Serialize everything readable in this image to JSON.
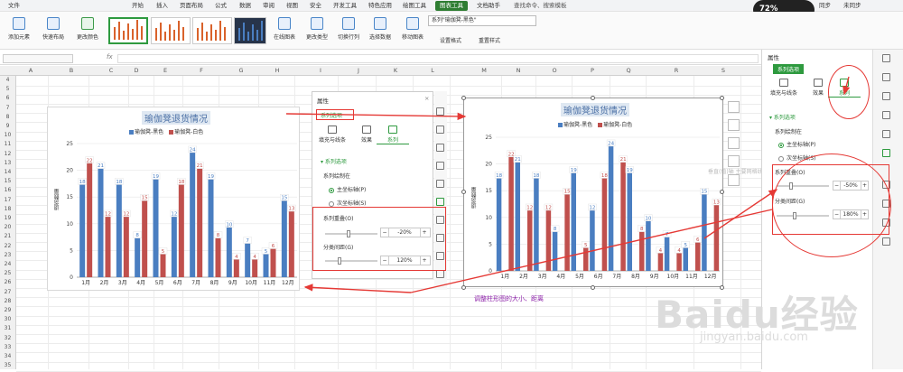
{
  "menubar": {
    "items": [
      "文件",
      "开始",
      "插入",
      "页面布局",
      "公式",
      "数据",
      "审阅",
      "视图",
      "安全",
      "开发工具",
      "特色应用",
      "绘图工具",
      "图表工具",
      "文档助手"
    ],
    "active": "图表工具",
    "search": "查找命令、搜索模板",
    "right_a": "同步",
    "right_b": "未同步"
  },
  "badge": {
    "value": "72%"
  },
  "ribbon": {
    "add_element": "添加元素",
    "quick_layout": "快速布局",
    "change_color": "更改颜色",
    "online_chart": "在线图表",
    "change_type": "更改类型",
    "switch_rowcol": "切换行列",
    "select_data": "选择数据",
    "move_chart": "移动图表",
    "style_select": "系列\"瑜伽凳-黑色\"",
    "set_format": "设置格式",
    "reset_style": "重置样式"
  },
  "formula": {
    "fx": "fx"
  },
  "columns": [
    "A",
    "B",
    "C",
    "D",
    "E",
    "F",
    "G",
    "H",
    "I",
    "J",
    "K",
    "L",
    "M",
    "N",
    "O",
    "P",
    "Q",
    "R",
    "S"
  ],
  "rows": [
    "4",
    "5",
    "6",
    "7",
    "8",
    "9",
    "10",
    "11",
    "12",
    "13",
    "14",
    "15",
    "16",
    "17",
    "18",
    "19",
    "20",
    "21",
    "22",
    "23",
    "24",
    "25",
    "26",
    "27",
    "28",
    "29",
    "30",
    "31",
    "32",
    "33",
    "34",
    "35"
  ],
  "chart_data": [
    {
      "type": "bar",
      "title": "瑜伽凳退货情况",
      "categories": [
        "1月",
        "2月",
        "3月",
        "4月",
        "5月",
        "6月",
        "7月",
        "8月",
        "9月",
        "10月",
        "11月",
        "12月"
      ],
      "series": [
        {
          "name": "瑜伽凳-黑色",
          "values": [
            18,
            21,
            18,
            8,
            19,
            12,
            24,
            19,
            10,
            7,
            5,
            15
          ],
          "color": "#4a7ec1"
        },
        {
          "name": "瑜伽凳-白色",
          "values": [
            22,
            12,
            12,
            15,
            5,
            18,
            21,
            8,
            4,
            4,
            6,
            13
          ],
          "color": "#c0504d"
        }
      ],
      "ylim": [
        0,
        25
      ],
      "yticks": [
        "0",
        "5",
        "10",
        "15",
        "20",
        "25"
      ],
      "ylabel": "退货数量"
    },
    {
      "type": "bar",
      "title": "瑜伽凳退货情况",
      "categories": [
        "1月",
        "2月",
        "3月",
        "4月",
        "5月",
        "6月",
        "7月",
        "8月",
        "9月",
        "10月",
        "11月",
        "12月"
      ],
      "series": [
        {
          "name": "瑜伽凳-黑色",
          "values": [
            18,
            21,
            18,
            8,
            19,
            12,
            24,
            19,
            10,
            7,
            5,
            15
          ],
          "color": "#4a7ec1"
        },
        {
          "name": "瑜伽凳-白色",
          "values": [
            22,
            12,
            12,
            15,
            5,
            18,
            21,
            8,
            4,
            4,
            6,
            13
          ],
          "color": "#c0504d"
        }
      ],
      "ylim": [
        0,
        25
      ],
      "yticks": [
        "0",
        "5",
        "10",
        "15",
        "20",
        "25"
      ],
      "ylabel": "退货数量"
    }
  ],
  "panel": {
    "title": "属性",
    "dropdown": "系列选项",
    "tab_fill": "填充与线条",
    "tab_effect": "效果",
    "tab_series": "系列",
    "section": "系列选项",
    "draw_on": "系列绘制在",
    "primary": "主坐标轴(P)",
    "secondary": "次坐标轴(S)",
    "overlap_label": "系列重叠(O)",
    "gap_label": "分类间距(G)",
    "minus": "−",
    "plus": "+"
  },
  "panel_small": {
    "overlap": "-20%",
    "gap": "120%"
  },
  "panel_right": {
    "overlap": "-50%",
    "gap": "180%",
    "ghost": "垂直(值)轴 主要网格线"
  },
  "annotation": "调整柱形图的大小、距离",
  "watermark": {
    "main": "Baidu经验",
    "sub": "jingyan.baidu.com"
  }
}
